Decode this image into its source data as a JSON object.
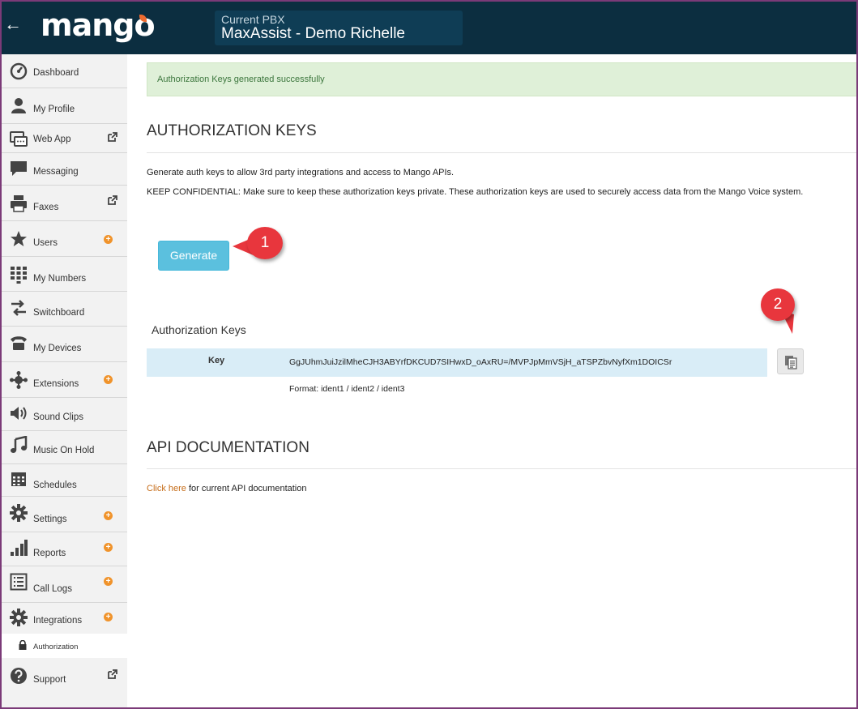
{
  "header": {
    "back_icon": "arrow-left-icon",
    "logo_text": "mango",
    "pbx_caption": "Current PBX",
    "pbx_name": "MaxAssist - Demo Richelle"
  },
  "sidebar": {
    "items": [
      {
        "label": "Dashboard",
        "icon": "dashboard-icon",
        "plus": false,
        "external": false
      },
      {
        "label": "My Profile",
        "icon": "user-icon",
        "plus": false,
        "external": false
      },
      {
        "label": "Web App",
        "icon": "web-app-icon",
        "plus": false,
        "external": true
      },
      {
        "label": "Messaging",
        "icon": "chat-icon",
        "plus": false,
        "external": false
      },
      {
        "label": "Faxes",
        "icon": "fax-icon",
        "plus": false,
        "external": true
      },
      {
        "label": "Users",
        "icon": "star-icon",
        "plus": true,
        "external": false
      },
      {
        "label": "My Numbers",
        "icon": "dialpad-icon",
        "plus": false,
        "external": false
      },
      {
        "label": "Switchboard",
        "icon": "switch-arrows-icon",
        "plus": false,
        "external": false
      },
      {
        "label": "My Devices",
        "icon": "phone-icon",
        "plus": false,
        "external": false
      },
      {
        "label": "Extensions",
        "icon": "extensions-icon",
        "plus": true,
        "external": false
      },
      {
        "label": "Sound Clips",
        "icon": "speaker-icon",
        "plus": false,
        "external": false
      },
      {
        "label": "Music On Hold",
        "icon": "music-note-icon",
        "plus": false,
        "external": false
      },
      {
        "label": "Schedules",
        "icon": "calendar-icon",
        "plus": false,
        "external": false
      },
      {
        "label": "Settings",
        "icon": "gear-icon",
        "plus": true,
        "external": false
      },
      {
        "label": "Reports",
        "icon": "bar-chart-icon",
        "plus": true,
        "external": false
      },
      {
        "label": "Call Logs",
        "icon": "list-icon",
        "plus": true,
        "external": false
      },
      {
        "label": "Integrations",
        "icon": "gear-icon",
        "plus": true,
        "external": false
      },
      {
        "label": "Support",
        "icon": "help-icon",
        "plus": false,
        "external": true
      }
    ],
    "sub_item": {
      "label": "Authorization",
      "icon": "lock-icon"
    }
  },
  "main": {
    "alert": "Authorization Keys generated successfully",
    "auth_title": "AUTHORIZATION KEYS",
    "desc_1": "Generate auth keys to allow 3rd party integrations and access to Mango APIs.",
    "desc_2": "KEEP CONFIDENTIAL: Make sure to keep these authorization keys private. These authorization keys are used to securely access data from the Mango Voice system.",
    "generate_label": "Generate",
    "keys_heading": "Authorization Keys",
    "key_label": "Key",
    "key_value": "GgJUhmJuiJzilMheCJH3ABYrfDKCUD7SIHwxD_oAxRU=/MVPJpMmVSjH_aTSPZbvNyfXm1DOICSr",
    "format_text": "Format: ident1 / ident2 / ident3",
    "api_title": "API DOCUMENTATION",
    "api_link": "Click here",
    "api_rest": " for current API documentation"
  },
  "callouts": {
    "one": "1",
    "two": "2"
  },
  "colors": {
    "header_bg": "#0c2e40",
    "accent_orange": "#f0932b",
    "button_blue": "#5bc0de",
    "alert_green": "#dff0d8",
    "callout_red": "#e8363d"
  }
}
